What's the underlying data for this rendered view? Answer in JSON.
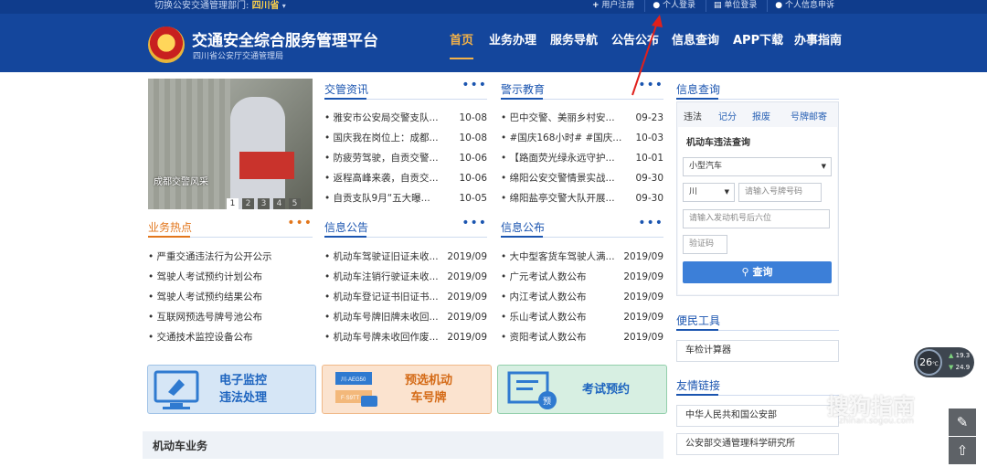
{
  "topbar": {
    "switch_label": "切换公安交通管理部门:",
    "province": "四川省",
    "links": [
      "用户注册",
      "个人登录",
      "单位登录",
      "个人信息申诉"
    ]
  },
  "header": {
    "title": "交通安全综合服务管理平台",
    "subtitle": "四川省公安厅交通管理局",
    "nav": [
      "首页",
      "业务办理",
      "服务导航",
      "公告公布",
      "信息查询",
      "APP下载",
      "办事指南"
    ],
    "active_nav": "首页"
  },
  "carousel": {
    "caption": "成都交警风采",
    "pages": [
      "1",
      "2",
      "3",
      "4",
      "5"
    ],
    "active_page": "1"
  },
  "sections": {
    "jgzx": {
      "title": "交管资讯",
      "items": [
        {
          "text": "雅安市公安局交警支队...",
          "date": "10-08"
        },
        {
          "text": "国庆我在岗位上：成都...",
          "date": "10-08"
        },
        {
          "text": "防疲劳驾驶，自贡交警...",
          "date": "10-06"
        },
        {
          "text": "返程高峰来袭，自贡交...",
          "date": "10-06"
        },
        {
          "text": "自贡支队9月“五大曝...",
          "date": "10-05"
        }
      ]
    },
    "jsjy": {
      "title": "警示教育",
      "items": [
        {
          "text": "巴中交警、美丽乡村安...",
          "date": "09-23"
        },
        {
          "text": "#国庆168小时# #国庆...",
          "date": "10-03"
        },
        {
          "text": "【路面荧光绿永远守护...",
          "date": "10-01"
        },
        {
          "text": "绵阳公安交警情景实战...",
          "date": "09-30"
        },
        {
          "text": "绵阳盐亭交警大队开展...",
          "date": "09-30"
        }
      ]
    },
    "ywrd": {
      "title": "业务热点",
      "items": [
        {
          "text": "严重交通违法行为公开公示"
        },
        {
          "text": "驾驶人考试预约计划公布"
        },
        {
          "text": "驾驶人考试预约结果公布"
        },
        {
          "text": "互联网预选号牌号池公布"
        },
        {
          "text": "交通技术监控设备公布"
        }
      ]
    },
    "xxgg": {
      "title": "信息公告",
      "items": [
        {
          "text": "机动车驾驶证旧证未收...",
          "date": "2019/09"
        },
        {
          "text": "机动车注销行驶证未收...",
          "date": "2019/09"
        },
        {
          "text": "机动车登记证书旧证书...",
          "date": "2019/09"
        },
        {
          "text": "机动车号牌旧牌未收回...",
          "date": "2019/09"
        },
        {
          "text": "机动车号牌未收回作废...",
          "date": "2019/09"
        }
      ]
    },
    "xxgb": {
      "title": "信息公布",
      "items": [
        {
          "text": "大中型客货车驾驶人满...",
          "date": "2019/09"
        },
        {
          "text": "广元考试人数公布",
          "date": "2019/09"
        },
        {
          "text": "内江考试人数公布",
          "date": "2019/09"
        },
        {
          "text": "乐山考试人数公布",
          "date": "2019/09"
        },
        {
          "text": "资阳考试人数公布",
          "date": "2019/09"
        }
      ]
    }
  },
  "tiles": [
    {
      "line1": "电子监控",
      "line2": "违法处理"
    },
    {
      "line1": "预选机动",
      "line2": "车号牌",
      "plate_text": "川·AEG50",
      "plate_text2": "F·S9TT"
    },
    {
      "line1": "考试预约",
      "line2": "",
      "badge": "预"
    }
  ],
  "moto_title": "机动车业务",
  "query": {
    "title": "信息查询",
    "tabs": [
      "违法",
      "记分",
      "报废",
      "号牌邮寄"
    ],
    "active_tab": "违法",
    "form_title": "机动车违法查询",
    "vehicle_type": "小型汽车",
    "province_prefix": "川",
    "plate_placeholder": "请输入号牌号码",
    "engine_placeholder": "请输入发动机号后六位",
    "captcha_placeholder": "验证码",
    "search_label": "查询"
  },
  "tools": {
    "title": "便民工具",
    "items": [
      "车检计算器"
    ]
  },
  "friend_links": {
    "title": "友情链接",
    "items": [
      "中华人民共和国公安部",
      "公安部交通管理科学研究所"
    ]
  },
  "weather": {
    "temp": "26",
    "unit": "℃",
    "high": "19.3",
    "low": "24.9"
  },
  "watermark": {
    "text": "搜狗指南",
    "sub": "zhinan.sogou.com"
  },
  "colors": {
    "header_blue": "#14469c",
    "accent_orange": "#f3b248",
    "link_blue": "#1b55b0",
    "section_orange": "#e2761c"
  }
}
